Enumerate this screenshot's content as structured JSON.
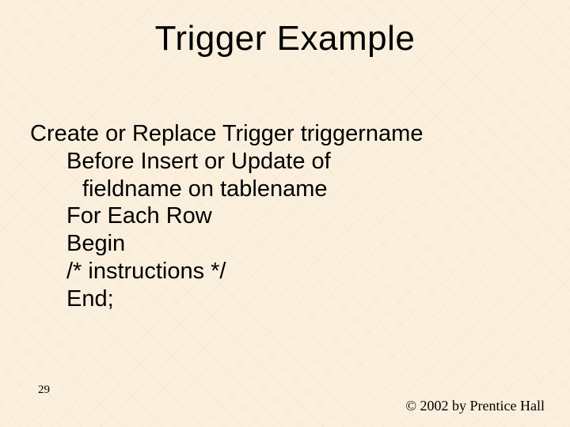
{
  "title": "Trigger Example",
  "lines": {
    "l0": "Create or Replace Trigger triggername",
    "l1": "Before Insert or Update of",
    "l2": "fieldname on tablename",
    "l3": "For Each Row",
    "l4": "Begin",
    "l5": "/* instructions */",
    "l6": "End;"
  },
  "slide_number": "29",
  "copyright": "© 2002 by Prentice Hall"
}
